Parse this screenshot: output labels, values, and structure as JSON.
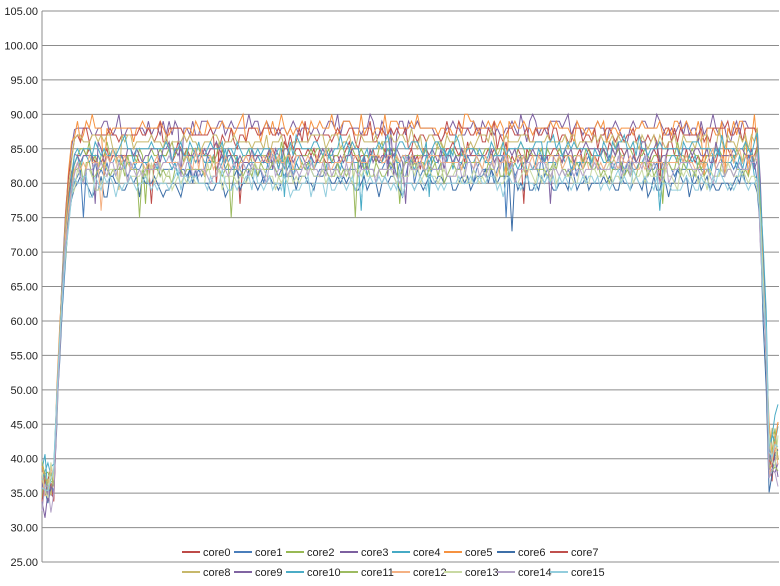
{
  "chart_data": {
    "type": "line",
    "title": "",
    "xlabel": "",
    "ylabel": "",
    "ylim": [
      25,
      105
    ],
    "yticks": [
      "25.00",
      "30.00",
      "35.00",
      "40.00",
      "45.00",
      "50.00",
      "55.00",
      "60.00",
      "65.00",
      "70.00",
      "75.00",
      "80.00",
      "85.00",
      "90.00",
      "95.00",
      "100.00",
      "105.00"
    ],
    "grid": true,
    "legend_position": "bottom",
    "x_count": 250,
    "series": [
      {
        "name": "core0",
        "color": "#be4b48",
        "start": 36,
        "plateau": 84,
        "end": 40
      },
      {
        "name": "core1",
        "color": "#4a7ebb",
        "start": 35,
        "plateau": 82,
        "end": 39
      },
      {
        "name": "core2",
        "color": "#98b954",
        "start": 37,
        "plateau": 84,
        "end": 41
      },
      {
        "name": "core3",
        "color": "#7d60a0",
        "start": 34,
        "plateau": 88,
        "end": 40
      },
      {
        "name": "core4",
        "color": "#46aac5",
        "start": 38,
        "plateau": 83,
        "end": 42
      },
      {
        "name": "core5",
        "color": "#f69240",
        "start": 37,
        "plateau": 88,
        "end": 42
      },
      {
        "name": "core6",
        "color": "#3d6fa8",
        "start": 36,
        "plateau": 80,
        "end": 38
      },
      {
        "name": "core7",
        "color": "#c0504d",
        "start": 35,
        "plateau": 87,
        "end": 41
      },
      {
        "name": "core8",
        "color": "#c7b86b",
        "start": 37,
        "plateau": 86,
        "end": 43
      },
      {
        "name": "core9",
        "color": "#8064a2",
        "start": 36,
        "plateau": 84,
        "end": 40
      },
      {
        "name": "core10",
        "color": "#4bacc6",
        "start": 38,
        "plateau": 85,
        "end": 45
      },
      {
        "name": "core11",
        "color": "#9dbb61",
        "start": 37,
        "plateau": 82,
        "end": 41
      },
      {
        "name": "core12",
        "color": "#f4b183",
        "start": 36,
        "plateau": 83,
        "end": 40
      },
      {
        "name": "core13",
        "color": "#c9d9a3",
        "start": 37,
        "plateau": 81,
        "end": 42
      },
      {
        "name": "core14",
        "color": "#b3a2c7",
        "start": 35,
        "plateau": 82,
        "end": 39
      },
      {
        "name": "core15",
        "color": "#93cddd",
        "start": 38,
        "plateau": 80,
        "end": 43
      }
    ]
  }
}
